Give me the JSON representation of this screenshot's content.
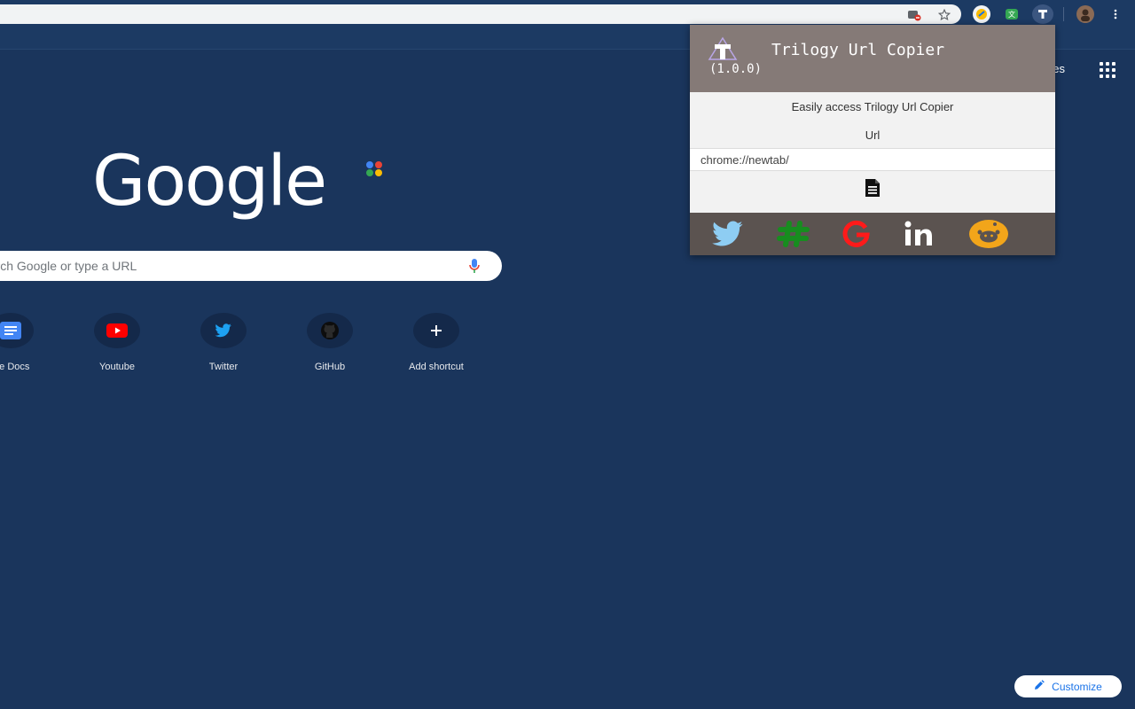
{
  "browser": {
    "icons": [
      "translate-blocked-icon",
      "bookmark-star-icon",
      "extension-icon",
      "extension-icon",
      "trilogy-extension-icon",
      "profile-avatar-icon",
      "more-vert-icon"
    ]
  },
  "ntp": {
    "top_right_link": "ges",
    "search_placeholder": "earch Google or type a URL",
    "logo_text": "Google",
    "logo_dot_colors": [
      "#4285f4",
      "#ea4335",
      "#34a853",
      "#fbbc05"
    ],
    "shortcuts": [
      {
        "label": "gle Docs",
        "icon": "google-docs-icon"
      },
      {
        "label": "Youtube",
        "icon": "youtube-icon"
      },
      {
        "label": "Twitter",
        "icon": "twitter-icon"
      },
      {
        "label": "GitHub",
        "icon": "github-icon"
      },
      {
        "label": "Add shortcut",
        "icon": "plus-icon"
      }
    ],
    "customize_label": "Customize"
  },
  "popup": {
    "title": "Trilogy Url Copier",
    "version": "(1.0.0)",
    "description": "Easily access Trilogy Url Copier",
    "url_label": "Url",
    "url_value": "chrome://newtab/",
    "share": [
      {
        "name": "twitter",
        "color": "#8ecdf3"
      },
      {
        "name": "slack-hash",
        "color": "#178d1f"
      },
      {
        "name": "google",
        "color": "#ff1a1a"
      },
      {
        "name": "linkedin",
        "color": "#ffffff"
      },
      {
        "name": "reddit",
        "color": "#f2a51a"
      }
    ],
    "colors": {
      "header": "#857a77",
      "footer": "#5b5350",
      "body": "#f2f2f2"
    }
  }
}
